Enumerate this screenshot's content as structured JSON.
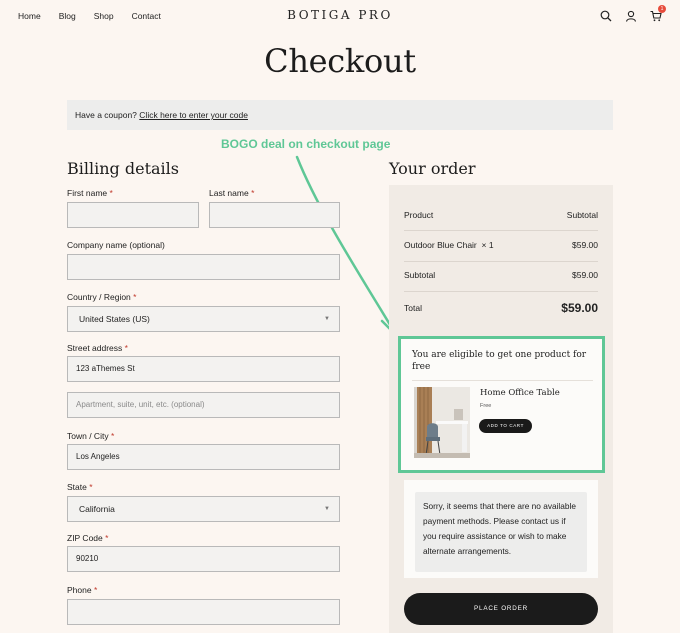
{
  "header": {
    "nav": [
      "Home",
      "Blog",
      "Shop",
      "Contact"
    ],
    "brand": "BOTIGA PRO",
    "cart_count": "1"
  },
  "page_title": "Checkout",
  "coupon": {
    "text": "Have a coupon?",
    "link": "Click here to enter your code"
  },
  "annotation": "BOGO deal on checkout page",
  "billing": {
    "title": "Billing details",
    "first_name_label": "First name",
    "last_name_label": "Last name",
    "company_label": "Company name (optional)",
    "country_label": "Country / Region",
    "country_value": "United States (US)",
    "street_label": "Street address",
    "street_value": "123 aThemes St",
    "street2_placeholder": "Apartment, suite, unit, etc. (optional)",
    "city_label": "Town / City",
    "city_value": "Los Angeles",
    "state_label": "State",
    "state_value": "California",
    "zip_label": "ZIP Code",
    "zip_value": "90210",
    "phone_label": "Phone",
    "required_mark": "*"
  },
  "order": {
    "title": "Your order",
    "col_product": "Product",
    "col_subtotal": "Subtotal",
    "item_name": "Outdoor Blue Chair",
    "item_qty": "× 1",
    "item_price": "$59.00",
    "subtotal_label": "Subtotal",
    "subtotal_value": "$59.00",
    "total_label": "Total",
    "total_value": "$59.00"
  },
  "bogo": {
    "title": "You are eligible to get one product for free",
    "product_name": "Home Office Table",
    "product_price": "Free",
    "button": "ADD TO CART"
  },
  "payment": {
    "message": "Sorry, it seems that there are no available payment methods. Please contact us if you require assistance or wish to make alternate arrangements."
  },
  "place_order": "PLACE ORDER",
  "colors": {
    "background": "#fcf6f1",
    "accent_green": "#5fc796",
    "button_dark": "#1b1b1b",
    "required_red": "#c0392b"
  }
}
